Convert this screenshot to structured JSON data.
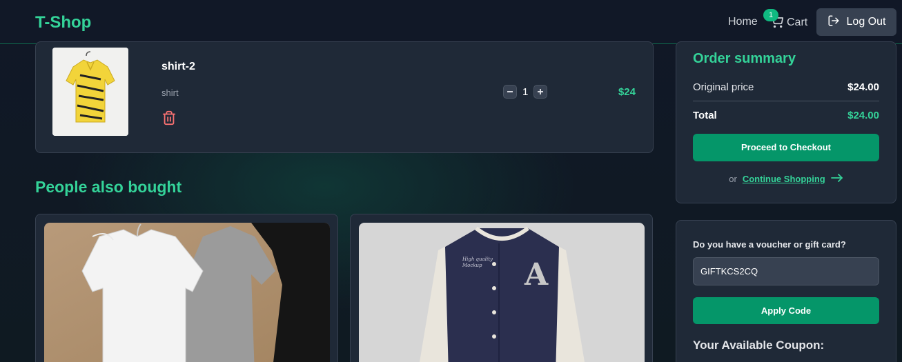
{
  "brand": "T-Shop",
  "nav": {
    "home": "Home",
    "cart": "Cart",
    "cart_count": "1",
    "logout": "Log Out"
  },
  "cart_item": {
    "name": "shirt-2",
    "category": "shirt",
    "quantity": "1",
    "price": "$24"
  },
  "recommendations": {
    "title": "People also bought"
  },
  "summary": {
    "title": "Order summary",
    "original_label": "Original price",
    "original_value": "$24.00",
    "total_label": "Total",
    "total_value": "$24.00",
    "checkout": "Proceed to Checkout",
    "or": "or",
    "continue": "Continue Shopping"
  },
  "voucher": {
    "label": "Do you have a voucher or gift card?",
    "value": "GIFTKCS2CQ",
    "apply": "Apply Code",
    "coupon_title": "Your Available Coupon:"
  },
  "colors": {
    "accent": "#34d399",
    "button": "#059669",
    "panel": "#1f2937",
    "background": "#111827",
    "danger": "#f87171"
  },
  "icons": {
    "cart": "cart-icon",
    "logout": "logout-icon",
    "delete": "trash-icon",
    "minus": "minus-icon",
    "plus": "plus-icon",
    "arrow": "arrow-right-icon"
  }
}
